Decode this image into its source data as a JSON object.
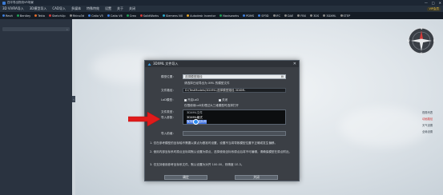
{
  "window": {
    "title": "四平导出物流VR场景",
    "controls": [
      "—",
      "□",
      "✕"
    ]
  },
  "menubar": {
    "items": [
      "3D ViVRA导入",
      "3D模型导入",
      "CAD导入",
      "多媒体",
      "特殊特效",
      "设置",
      "关于",
      "关闭"
    ],
    "vip_label": "VIP会员"
  },
  "toolbar": {
    "items": [
      {
        "label": "Revit",
        "color": "#3d7edb"
      },
      {
        "label": "Bentley",
        "color": "#1f9d55"
      },
      {
        "label": "Tekla",
        "color": "#e06b2a"
      },
      {
        "label": "SketchUp",
        "color": "#d23a3a"
      },
      {
        "label": "Rhino3d",
        "color": "#8a8a8a"
      },
      {
        "label": "Catia V5",
        "color": "#3d7edb"
      },
      {
        "label": "Catia V6",
        "color": "#3d7edb"
      },
      {
        "label": "Creo",
        "color": "#1f9d55"
      },
      {
        "label": "SolidWorks",
        "color": "#d23a3a"
      },
      {
        "label": "Siemens NX",
        "color": "#2aa7c9"
      },
      {
        "label": "Autodesk Inventor",
        "color": "#e0a32a"
      },
      {
        "label": "Navisworks",
        "color": "#1f9d55"
      },
      {
        "label": "PDMS",
        "color": "#3d7edb"
      },
      {
        "label": "SP3D",
        "color": "#3d7edb"
      },
      {
        "label": "IFC",
        "color": "#8a8a8a"
      },
      {
        "label": "DAE",
        "color": "#8a8a8a"
      },
      {
        "label": "FBX",
        "color": "#8a8a8a"
      },
      {
        "label": "3DS",
        "color": "#8a8a8a"
      },
      {
        "label": "3DXML",
        "color": "#8a8a8a"
      },
      {
        "label": "STEP",
        "color": "#8a8a8a"
      }
    ]
  },
  "sidebar": {
    "collapse_glyph": "‹"
  },
  "dialog": {
    "title": "3DXML 文件导入",
    "close_glyph": "✕",
    "fields": {
      "model_location_label": "模型位置：",
      "model_location_value": "选择模型路径",
      "model_location_hint": "请选择已经导出为 XML 的模型文件",
      "file_path_label": "文件路径：",
      "file_path_value": "D:\\TestModels\\3DXML\\选择模型路径.3DXML",
      "lod_label": "LoD模型：",
      "lod_option_1": "开启LoD",
      "lod_option_2": "关闭",
      "lod_hint": "仅限使用LoD处理过大三维模型时选择打开",
      "file_type_label": "文件类型：",
      "file_type_value": "3DXML文件",
      "import_param_label": "导入参数：",
      "import_param_line1": "3DXML格式",
      "import_param_line2": "保持原始坐标系",
      "import_prefix_label": "导入前缀："
    },
    "notes": [
      "1. 仅在参考模型的坐标轴不需要以原点为基准时设置，设置不当将导致模型位置不正确或发生偏移。",
      "2. 使用内部坐标系时原点坐标将默认设置为原点，选择使用坐标系原点后将不可编辑，请确保模型在原点附近。",
      "3. 仅支持使用参考坐标系文件，默认设置为对齐 100.00，则精度 1E-3。"
    ],
    "ok_label": "确定",
    "cancel_label": "关闭"
  },
  "right_panel": {
    "items": [
      "视角列表",
      "动画路径",
      "天气设置",
      "全局设置"
    ],
    "active_index": 1
  },
  "compass": {
    "labels": [
      "N",
      "E",
      "S",
      "W"
    ]
  }
}
